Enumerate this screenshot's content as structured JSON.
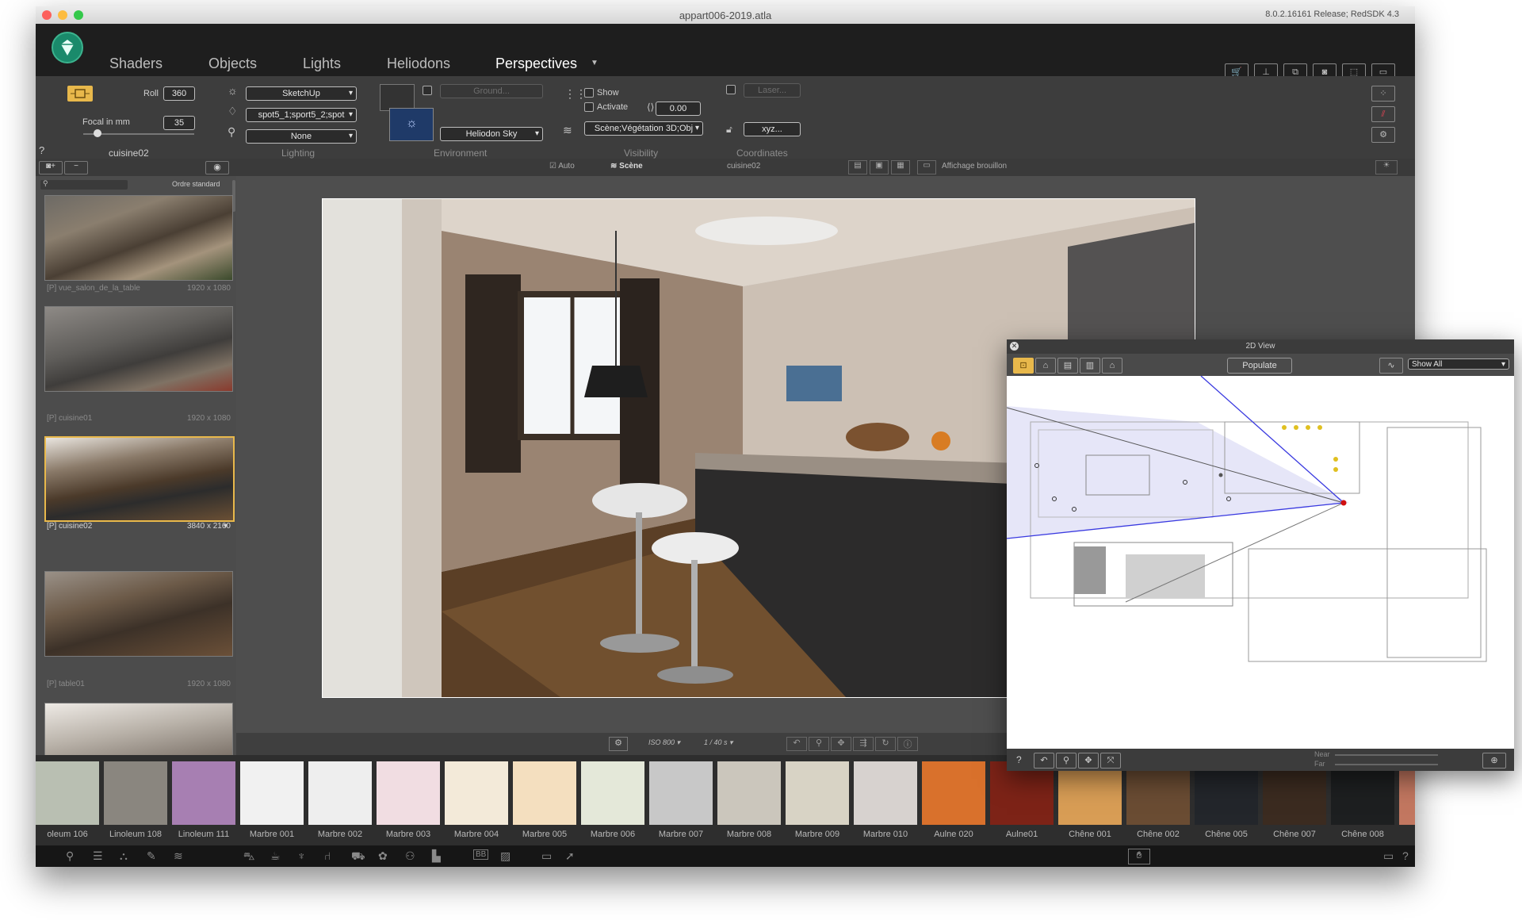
{
  "window": {
    "title": "appart006-2019.atla",
    "version": "8.0.2.16161 Release; RedSDK 4.3"
  },
  "menu": {
    "items": [
      "Shaders",
      "Objects",
      "Lights",
      "Heliodons",
      "Perspectives"
    ],
    "active": "Perspectives"
  },
  "toolbar": {
    "roll_label": "Roll",
    "roll_value": "360",
    "focal_label": "Focal in mm",
    "focal_value": "35",
    "camera_name": "cuisine02",
    "help": "?",
    "lighting": {
      "renderer": "SketchUp",
      "lights": "spot5_1;sport5_2;spot",
      "preset": "None",
      "section": "Lighting"
    },
    "environment": {
      "ground": "Ground...",
      "sky": "Heliodon Sky",
      "section": "Environment"
    },
    "visibility": {
      "show": "Show",
      "activate": "Activate",
      "value": "0.00",
      "layers": "Scène;Végétation 3D;Obj",
      "section": "Visibility"
    },
    "coordinates": {
      "laser": "Laser...",
      "xyz": "xyz...",
      "section": "Coordinates"
    }
  },
  "subbar": {
    "sort": "Ordre standard",
    "auto": "Auto",
    "scene": "Scène",
    "camera": "cuisine02",
    "draft": "Affichage brouillon"
  },
  "perspectives": [
    {
      "name": "[P] vue_salon_de_la_table",
      "size": "1920 x 1080"
    },
    {
      "name": "[P] cuisine01",
      "size": "1920 x 1080"
    },
    {
      "name": "[P] cuisine02",
      "size": "3840 x 2160",
      "selected": true
    },
    {
      "name": "[P] table01",
      "size": "1920 x 1080"
    }
  ],
  "viewport_bar": {
    "iso": "ISO 800",
    "shutter": "1 / 40 s"
  },
  "view2d": {
    "title": "2D View",
    "populate": "Populate",
    "show": "Show All",
    "near": "Near",
    "far": "Far",
    "help": "?"
  },
  "materials": [
    {
      "name": "oleum 106",
      "color": "#b9bfb2"
    },
    {
      "name": "Linoleum 108",
      "color": "#8a867f"
    },
    {
      "name": "Linoleum 111",
      "color": "#a77fb2"
    },
    {
      "name": "Marbre 001",
      "color": "#f1f1f1"
    },
    {
      "name": "Marbre 002",
      "color": "#eeeeee"
    },
    {
      "name": "Marbre 003",
      "color": "#f1dde2"
    },
    {
      "name": "Marbre 004",
      "color": "#f3ead9"
    },
    {
      "name": "Marbre 005",
      "color": "#f4dfbf"
    },
    {
      "name": "Marbre 006",
      "color": "#e4e8d9"
    },
    {
      "name": "Marbre 007",
      "color": "#c8c8c8"
    },
    {
      "name": "Marbre 008",
      "color": "#cbc6bc"
    },
    {
      "name": "Marbre 009",
      "color": "#d8d3c5"
    },
    {
      "name": "Marbre 010",
      "color": "#d7d2cf"
    },
    {
      "name": "Aulne 020",
      "color": "#d9712c"
    },
    {
      "name": "Aulne01",
      "color": "#7d2317"
    },
    {
      "name": "Chêne 001",
      "color": "#d89d55"
    },
    {
      "name": "Chêne 002",
      "color": "#6a4c33"
    },
    {
      "name": "Chêne 005",
      "color": "#23262b"
    },
    {
      "name": "Chêne 007",
      "color": "#3b2b20"
    },
    {
      "name": "Chêne 008",
      "color": "#1d1f20"
    },
    {
      "name": "Parqu",
      "color": "#c27760"
    }
  ],
  "colors": {
    "accent": "#e8b84b",
    "menubar": "#1e1e1e",
    "panel": "#3d3d3d"
  }
}
